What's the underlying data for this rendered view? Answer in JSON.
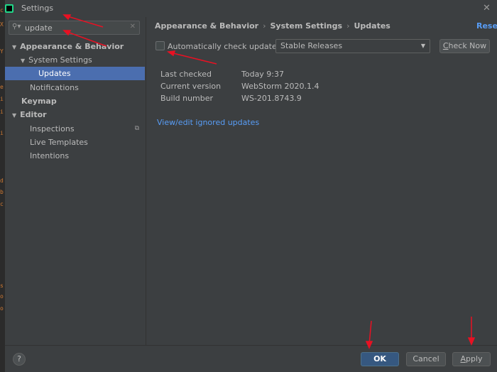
{
  "window": {
    "title": "Settings",
    "close_glyph": "✕"
  },
  "search": {
    "value": "update",
    "icon": "search-icon",
    "clear_glyph": "✕"
  },
  "tree": {
    "appearance": "Appearance & Behavior",
    "system_settings": "System Settings",
    "updates": "Updates",
    "notifications": "Notifications",
    "keymap": "Keymap",
    "editor": "Editor",
    "inspections": "Inspections",
    "live_templates": "Live Templates",
    "intentions": "Intentions"
  },
  "breadcrumb": {
    "part1": "Appearance & Behavior",
    "part2": "System Settings",
    "part3": "Updates",
    "sep": "›"
  },
  "reset_label": "Reset",
  "updates": {
    "auto_check_label": "Automatically check updates for",
    "auto_check_checked": false,
    "channel": "Stable Releases",
    "check_now_label_accel": "C",
    "check_now_label_rest": "heck Now",
    "info": {
      "last_checked_label": "Last checked",
      "last_checked_value": "Today 9:37",
      "current_version_label": "Current version",
      "current_version_value": "WebStorm 2020.1.4",
      "build_number_label": "Build number",
      "build_number_value": "WS-201.8743.9"
    },
    "view_ignored_label": "View/edit ignored updates"
  },
  "footer": {
    "help_label": "?",
    "ok_label": "OK",
    "cancel_label": "Cancel",
    "apply_accel": "A",
    "apply_rest": "pply"
  },
  "gutter_chars": [
    "c",
    "X",
    "Y",
    "e",
    "i",
    "i",
    "i",
    "d",
    "b",
    "c",
    "s",
    "o",
    "o"
  ],
  "colors": {
    "accent": "#4b6eaf",
    "link": "#589df6",
    "ok_button": "#365880",
    "annotation": "#e81123"
  }
}
